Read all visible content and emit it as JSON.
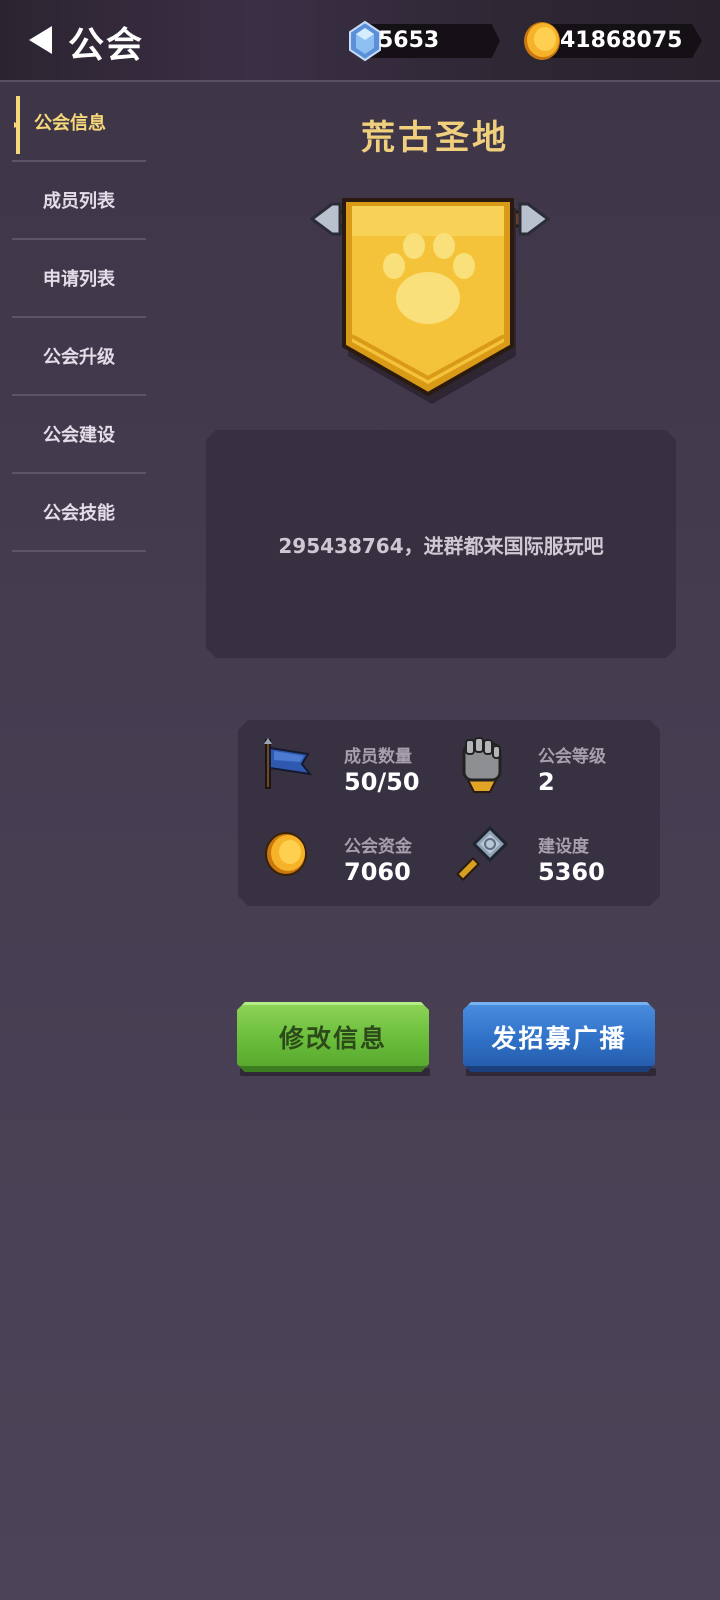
{
  "header": {
    "title": "公会",
    "gems": "5653",
    "coins": "41868075"
  },
  "sidebar": {
    "items": [
      {
        "label": "公会信息",
        "active": true
      },
      {
        "label": "成员列表",
        "active": false
      },
      {
        "label": "申请列表",
        "active": false
      },
      {
        "label": "公会升级",
        "active": false
      },
      {
        "label": "公会建设",
        "active": false
      },
      {
        "label": "公会技能",
        "active": false
      }
    ]
  },
  "guild": {
    "name": "荒古圣地",
    "emblem": "paw-icon",
    "motto": "295438764，进群都来国际服玩吧"
  },
  "stats": {
    "members_label": "成员数量",
    "members_value": "50/50",
    "level_label": "公会等级",
    "level_value": "2",
    "funds_label": "公会资金",
    "funds_value": "7060",
    "build_label": "建设度",
    "build_value": "5360"
  },
  "buttons": {
    "edit_label": "修改信息",
    "recruit_label": "发招募广播"
  },
  "colors": {
    "accent_gold": "#f0cf7d",
    "button_green": "#6cbf3c",
    "button_blue": "#2f70c6",
    "background": "#463c50"
  }
}
